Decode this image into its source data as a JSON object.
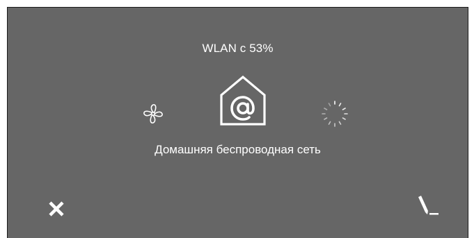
{
  "status": {
    "text": "WLAN с 53%"
  },
  "network": {
    "name": "Домашняя беспроводная сеть"
  },
  "icons": {
    "left": "fan-icon",
    "center": "home-network-at-icon",
    "right": "loading-spinner-icon",
    "close": "close-icon",
    "edit": "pencil-icon"
  },
  "colors": {
    "screen_background": "#666666",
    "foreground": "#ffffff",
    "frame": "#1a1a1a"
  }
}
